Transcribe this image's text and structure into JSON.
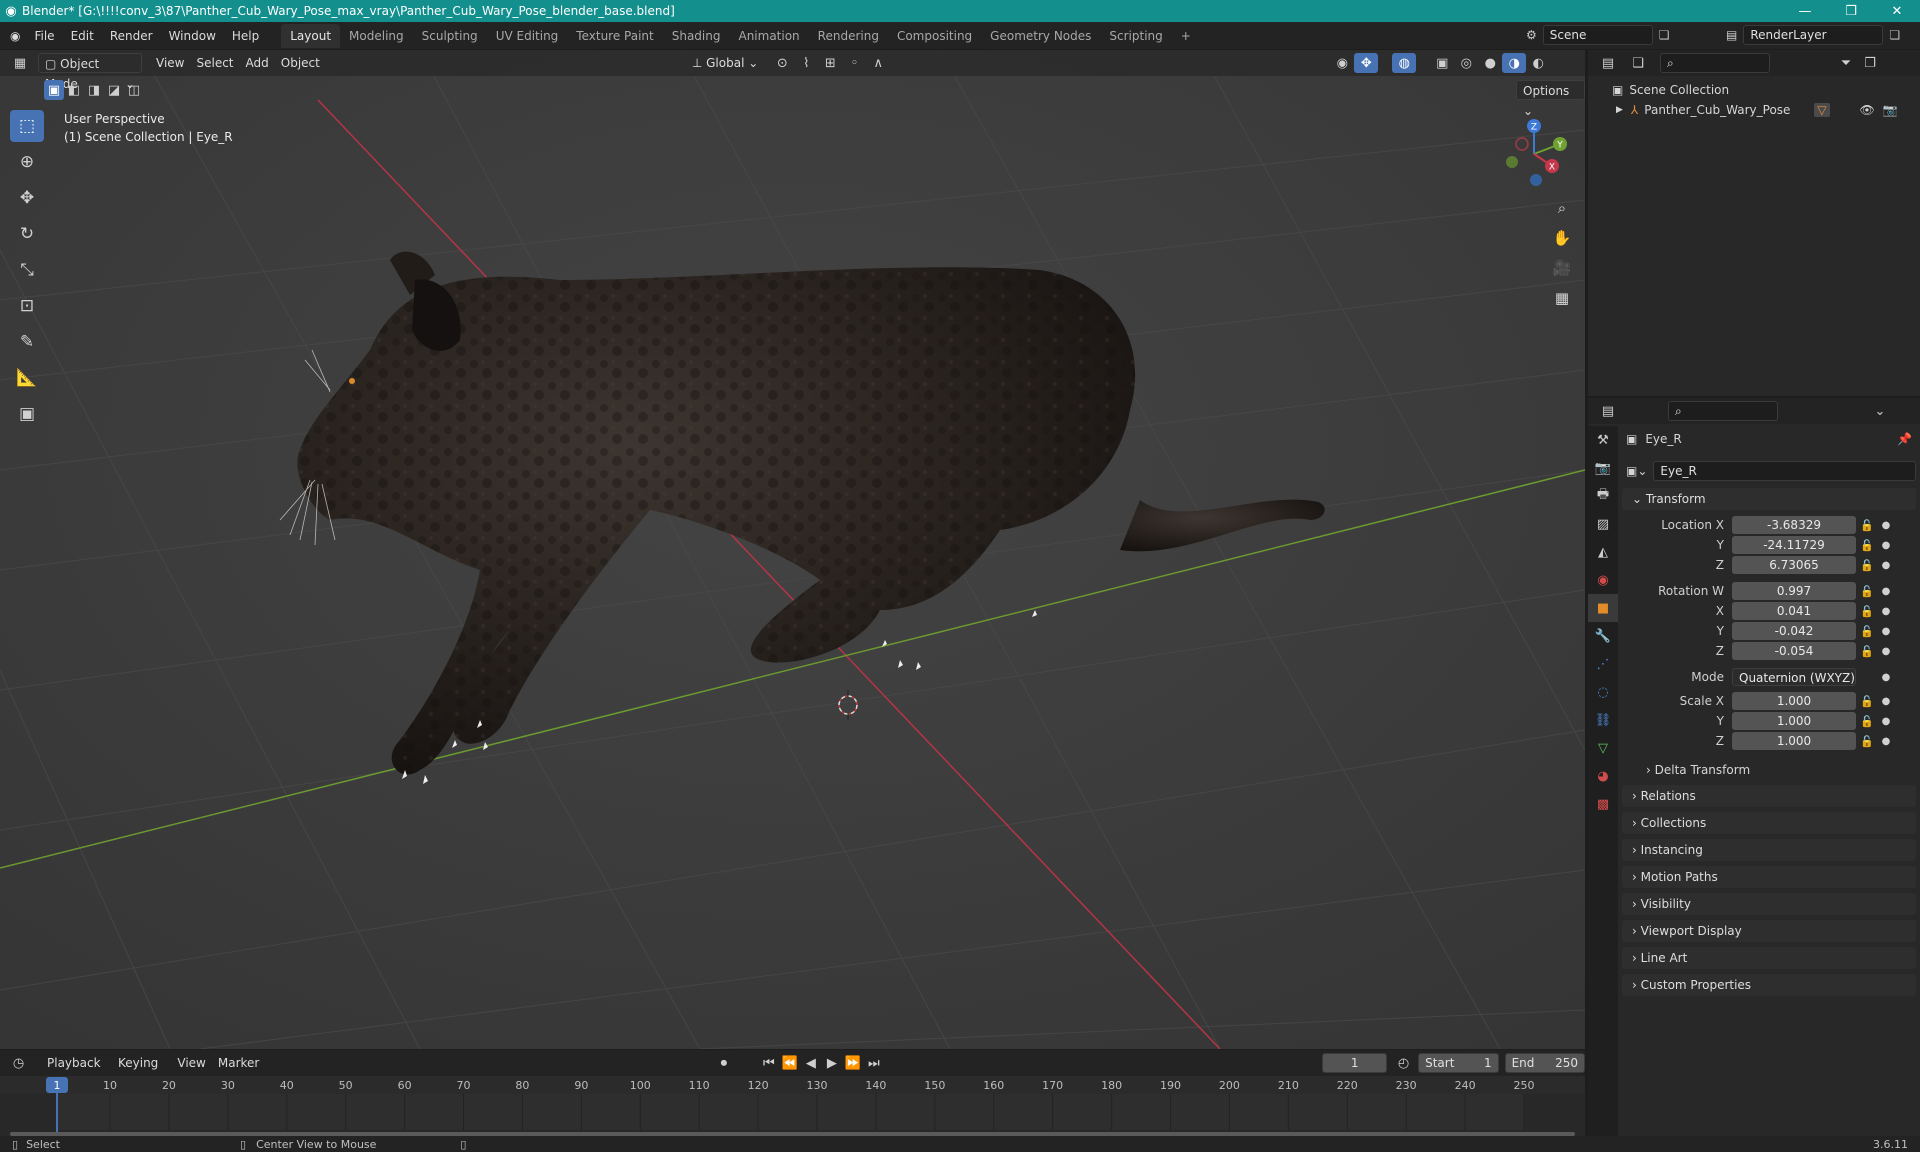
{
  "window": {
    "title": "Blender* [G:\\!!!!conv_3\\87\\Panther_Cub_Wary_Pose_max_vray\\Panther_Cub_Wary_Pose_blender_base.blend]"
  },
  "menu": {
    "items": [
      "File",
      "Edit",
      "Render",
      "Window",
      "Help"
    ],
    "workspaces": [
      "Layout",
      "Modeling",
      "Sculpting",
      "UV Editing",
      "Texture Paint",
      "Shading",
      "Animation",
      "Rendering",
      "Compositing",
      "Geometry Nodes",
      "Scripting"
    ],
    "add_tab": "+",
    "scene": "Scene",
    "render_layer": "RenderLayer"
  },
  "viewport": {
    "mode": "Object Mode",
    "menus": [
      "View",
      "Select",
      "Add",
      "Object"
    ],
    "orientation": "Global",
    "options": "Options",
    "info_line1": "User Perspective",
    "info_line2": "(1) Scene Collection | Eye_R",
    "gizmo": {
      "x": "X",
      "y": "Y",
      "z": "Z"
    }
  },
  "outliner": {
    "root": "Scene Collection",
    "item": "Panther_Cub_Wary_Pose"
  },
  "properties": {
    "object_name": "Eye_R",
    "data_name": "Eye_R",
    "transform_title": "Transform",
    "location_label": "Location X",
    "location": {
      "x": "-3.68329",
      "y": "-24.11729",
      "z": "6.73065"
    },
    "rotation_label": "Rotation W",
    "rotation": {
      "w": "0.997",
      "x": "0.041",
      "y": "-0.042",
      "z": "-0.054"
    },
    "mode_label": "Mode",
    "mode_value": "Quaternion (WXYZ)",
    "scale_label": "Scale X",
    "scale": {
      "x": "1.000",
      "y": "1.000",
      "z": "1.000"
    },
    "axis_labels": {
      "x": "X",
      "y": "Y",
      "z": "Z"
    },
    "delta_transform": "Delta Transform",
    "panels": [
      "Relations",
      "Collections",
      "Instancing",
      "Motion Paths",
      "Visibility",
      "Viewport Display",
      "Line Art",
      "Custom Properties"
    ]
  },
  "timeline": {
    "menus": [
      "Playback",
      "Keying",
      "View",
      "Marker"
    ],
    "current_frame": "1",
    "start_label": "Start",
    "start": "1",
    "end_label": "End",
    "end": "250",
    "ticks": [
      "1",
      "10",
      "20",
      "30",
      "40",
      "50",
      "60",
      "70",
      "80",
      "90",
      "100",
      "110",
      "120",
      "130",
      "140",
      "150",
      "160",
      "170",
      "180",
      "190",
      "200",
      "210",
      "220",
      "230",
      "240",
      "250"
    ]
  },
  "status": {
    "select": "Select",
    "center_view": "Center View to Mouse",
    "version": "3.6.11"
  },
  "colors": {
    "accent": "#4772b3",
    "titlebar": "#138f8e",
    "x_axis": "#c6374a",
    "y_axis": "#6fa233",
    "playhead": "#4772b3"
  }
}
